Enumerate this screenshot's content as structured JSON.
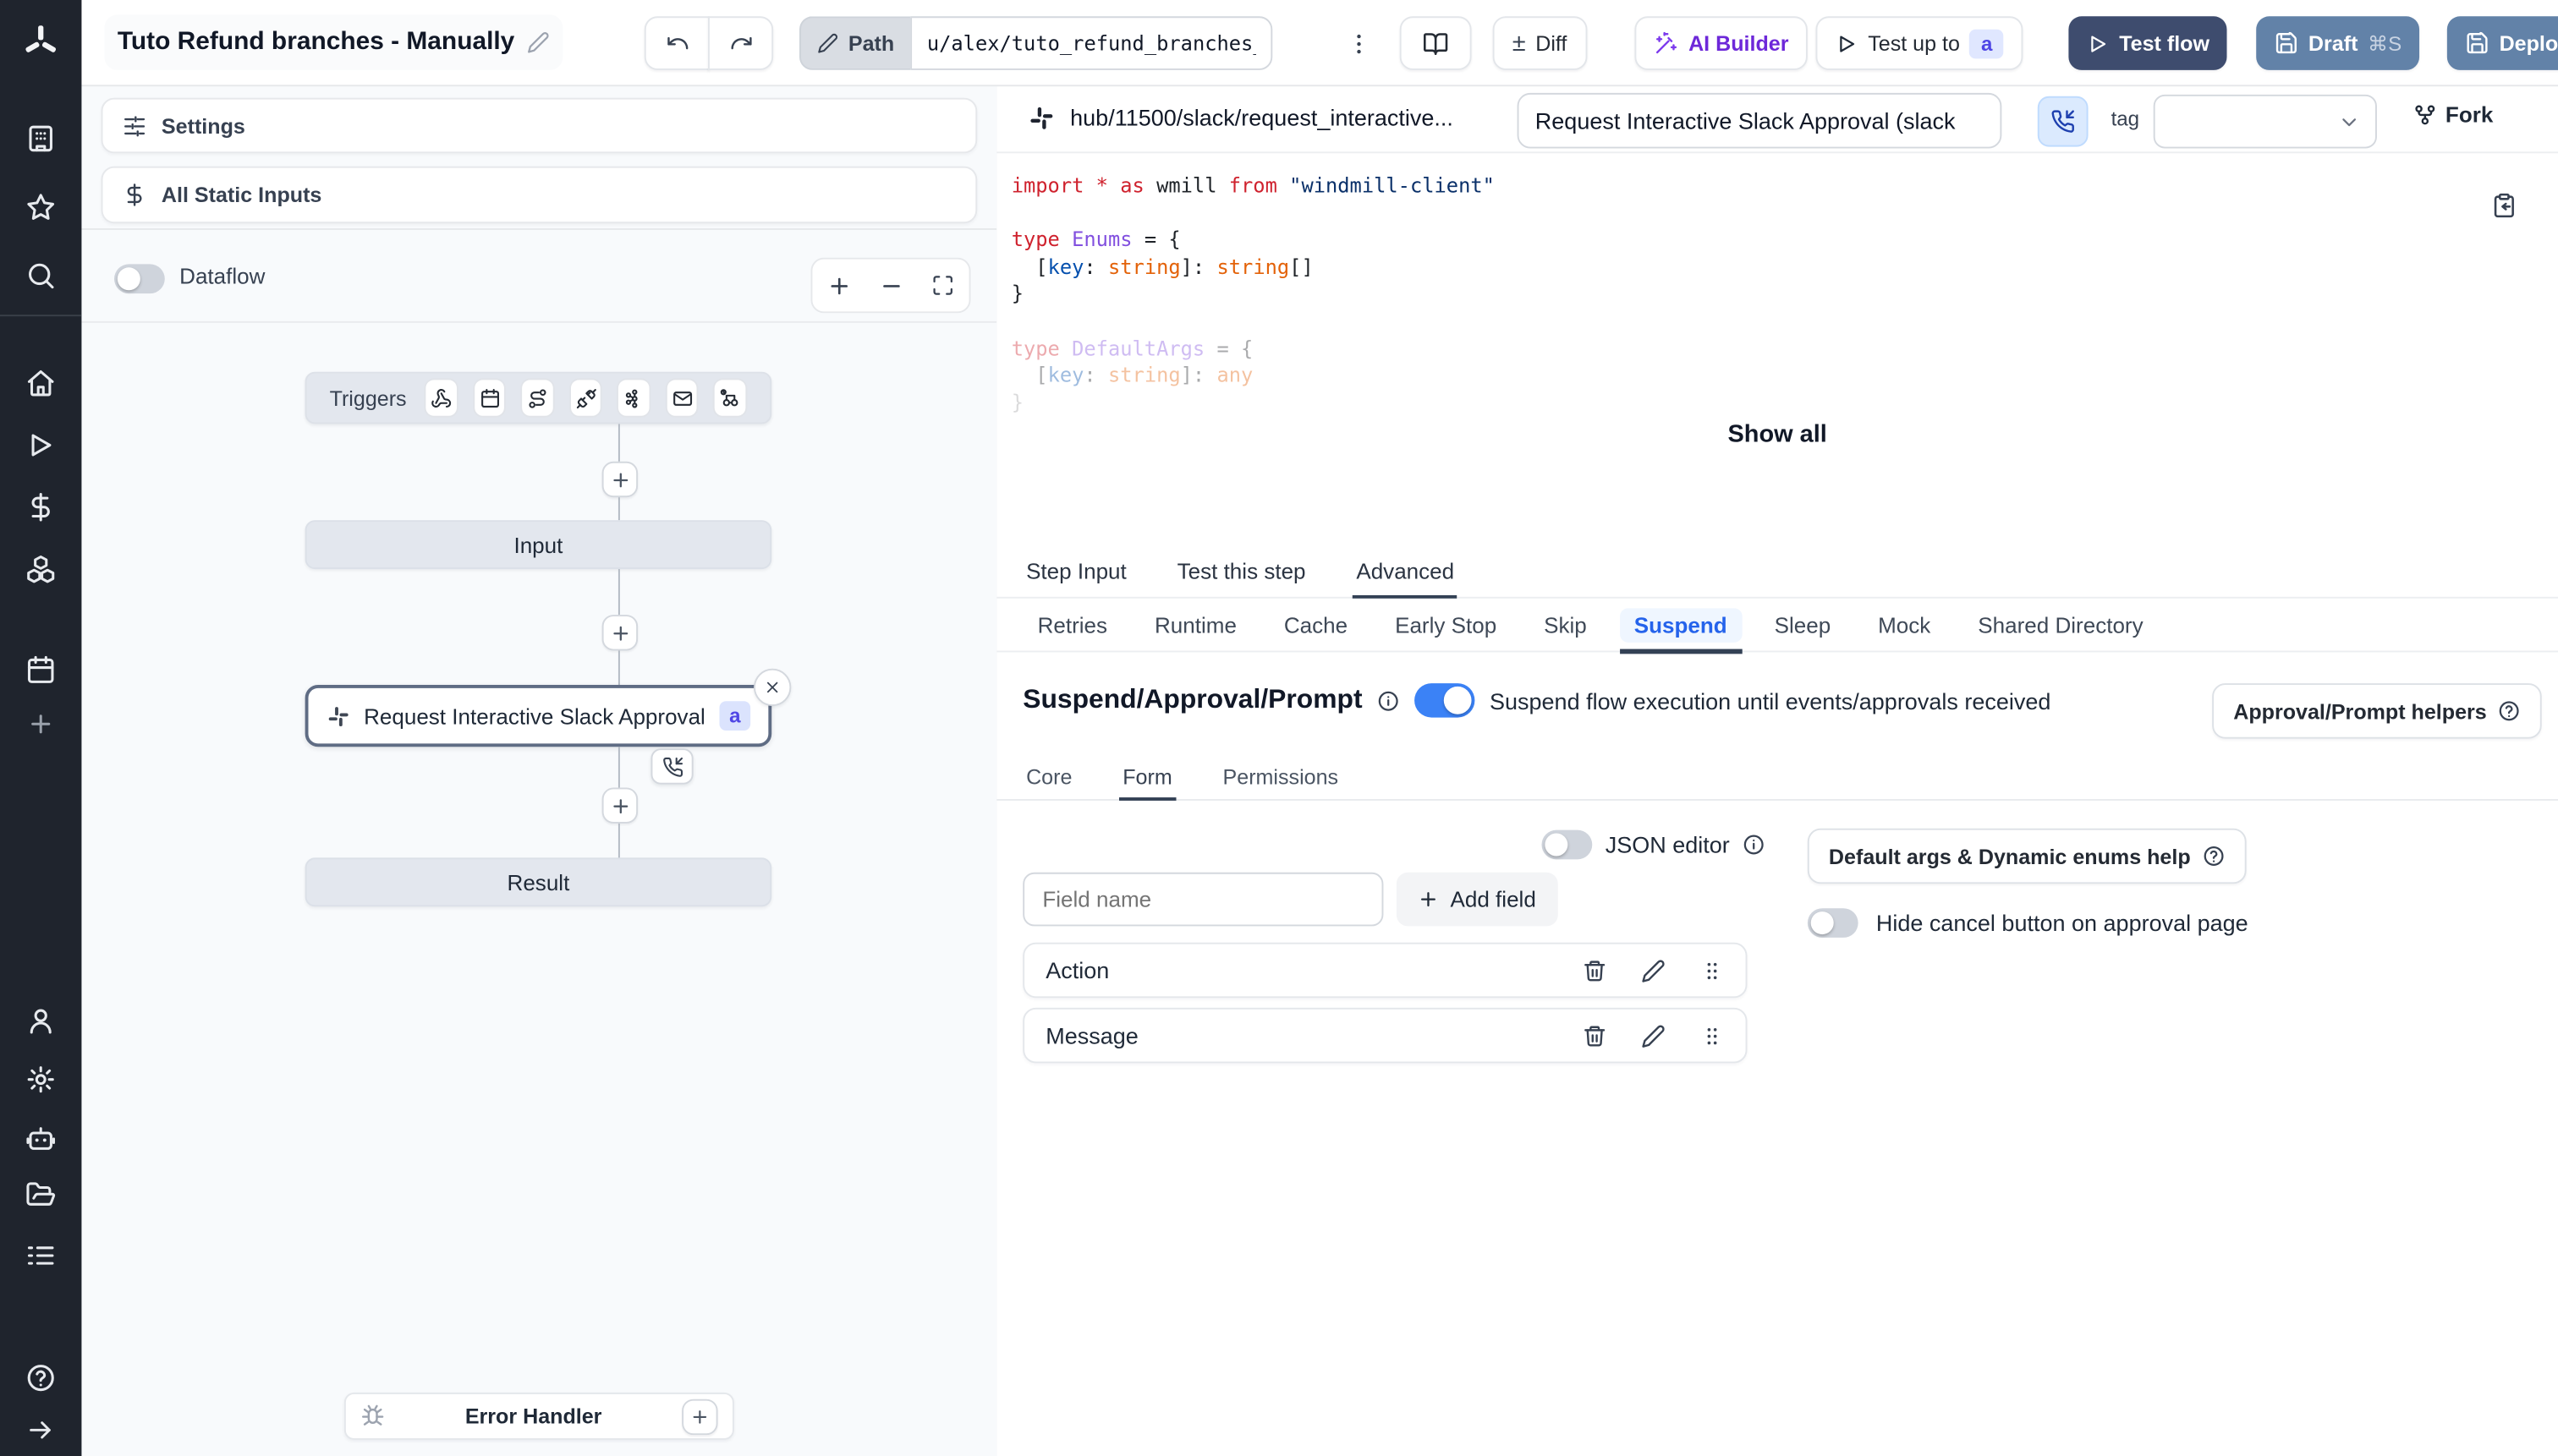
{
  "topbar": {
    "title": "Tuto Refund branches - Manually",
    "path_label": "Path",
    "path_value": "u/alex/tuto_refund_branches_",
    "plusminus": "±",
    "diff_label": "Diff",
    "ai_builder_label": "AI Builder",
    "test_up_to_label": "Test up to",
    "test_up_to_badge": "a",
    "test_flow_label": "Test flow",
    "draft_label": "Draft",
    "draft_shortcut": "⌘S",
    "deploy_label": "Deploy"
  },
  "sidebar": {
    "top_items": [
      "workspace",
      "favorites",
      "search"
    ],
    "menu_items": [
      "home",
      "runs",
      "variables",
      "resources",
      "schedules",
      "create"
    ],
    "bottom_items": [
      "account",
      "settings",
      "workers",
      "folders",
      "audit-logs"
    ],
    "footer_items": [
      "help",
      "collapse"
    ]
  },
  "left_panel": {
    "settings_label": "Settings",
    "static_inputs_label": "All Static Inputs",
    "dataflow_label": "Dataflow",
    "graph": {
      "triggers_label": "Triggers",
      "trigger_icons": [
        "webhook",
        "schedule",
        "route",
        "websocket",
        "kafka",
        "email",
        "poll"
      ],
      "input_label": "Input",
      "step": {
        "title": "Request Interactive Slack Approval (...",
        "badge": "a"
      },
      "result_label": "Result",
      "error_handler_label": "Error Handler"
    }
  },
  "right_panel": {
    "header": {
      "hub_path": "hub/11500/slack/request_interactive...",
      "name_value": "Request Interactive Slack Approval (slack",
      "tag_label": "tag",
      "fork_label": "Fork"
    },
    "show_all": "Show all",
    "tabs": {
      "items": [
        "Step Input",
        "Test this step",
        "Advanced"
      ],
      "active": "Advanced"
    },
    "subtabs": {
      "items": [
        "Retries",
        "Runtime",
        "Cache",
        "Early Stop",
        "Skip",
        "Suspend",
        "Sleep",
        "Mock",
        "Shared Directory"
      ],
      "active": "Suspend"
    },
    "suspend": {
      "heading": "Suspend/Approval/Prompt",
      "toggle_on": true,
      "toggle_caption": "Suspend flow execution until events/approvals received",
      "helpers_label": "Approval/Prompt helpers",
      "inner_tabs": {
        "items": [
          "Core",
          "Form",
          "Permissions"
        ],
        "active": "Form"
      },
      "form": {
        "json_editor_label": "JSON editor",
        "field_placeholder": "Field name",
        "add_field_label": "Add field",
        "fields": [
          {
            "name": "Action"
          },
          {
            "name": "Message"
          }
        ],
        "default_args_label": "Default args & Dynamic enums help",
        "hide_cancel_label": "Hide cancel button on approval page"
      }
    }
  },
  "code": {
    "lines": [
      {
        "t": [
          [
            "import",
            "kw"
          ],
          [
            " ",
            "p"
          ],
          [
            "*",
            "kw"
          ],
          [
            " ",
            "p"
          ],
          [
            "as",
            "kw"
          ],
          [
            " wmill ",
            "p"
          ],
          [
            "from",
            "kw"
          ],
          [
            " ",
            "p"
          ],
          [
            "\"windmill-client\"",
            "str"
          ]
        ]
      },
      {
        "t": []
      },
      {
        "t": [
          [
            "type",
            "kw"
          ],
          [
            " ",
            "p"
          ],
          [
            "Enums",
            "type"
          ],
          [
            " = {",
            "p"
          ]
        ]
      },
      {
        "t": [
          [
            "  [",
            "p"
          ],
          [
            "key",
            "prop"
          ],
          [
            ": ",
            "p"
          ],
          [
            "string",
            "bi"
          ],
          [
            "]: ",
            "p"
          ],
          [
            "string",
            "bi"
          ],
          [
            "[]",
            "p"
          ]
        ]
      },
      {
        "t": [
          [
            "}",
            "p"
          ]
        ]
      },
      {
        "t": []
      },
      {
        "t": [
          [
            "type",
            "kw"
          ],
          [
            " ",
            "p"
          ],
          [
            "DefaultArgs",
            "type"
          ],
          [
            " = {",
            "p"
          ]
        ],
        "fade": 1
      },
      {
        "t": [
          [
            "  [",
            "p"
          ],
          [
            "key",
            "prop"
          ],
          [
            ": ",
            "p"
          ],
          [
            "string",
            "bi"
          ],
          [
            "]: ",
            "p"
          ],
          [
            "any",
            "bi"
          ]
        ],
        "fade": 1
      },
      {
        "t": [
          [
            "}",
            "p"
          ]
        ],
        "fade": 2
      }
    ]
  },
  "colors": {
    "accent_blue": "#3b82f6",
    "active_tab_blue": "#2563eb",
    "test_flow_bg": "#3e4c6e",
    "draft_deploy_bg": "#6282a8",
    "ai_builder_purple": "#6d28d9",
    "badge_bg": "#e0e7ff",
    "badge_text": "#4f46e5",
    "sidebar_bg": "#1f242d",
    "graph_bg": "#f8fafc",
    "code_keyword": "#cf222e",
    "code_type": "#8250df",
    "code_property": "#0550ae",
    "code_builtin": "#e36209",
    "code_string": "#0a3069"
  }
}
